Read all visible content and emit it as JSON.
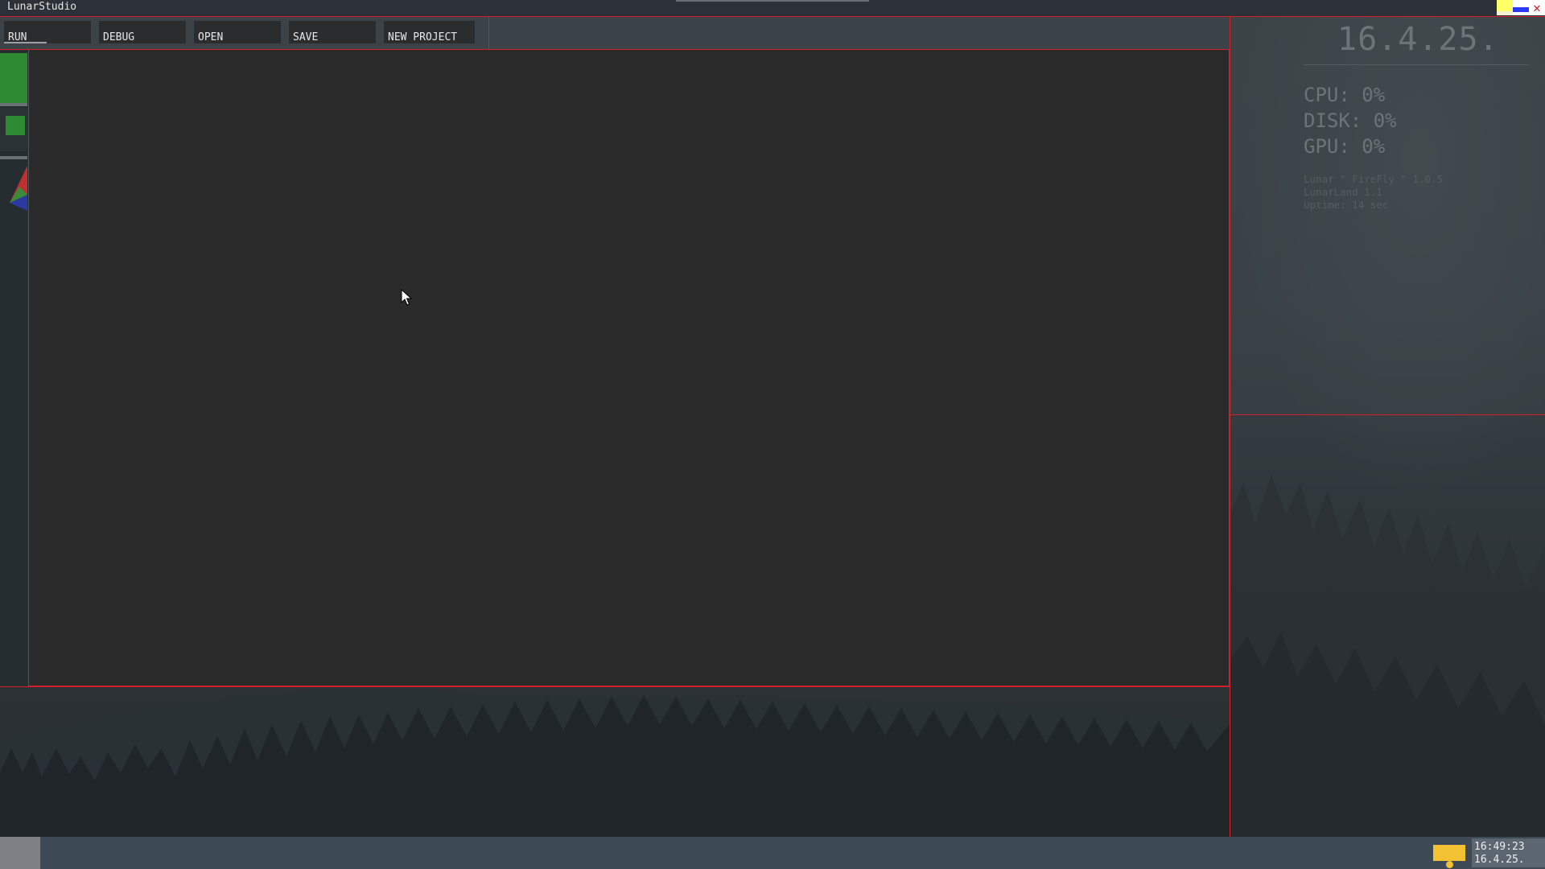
{
  "window": {
    "title": "LunarStudio",
    "controls": [
      "minimize",
      "maximize",
      "close"
    ]
  },
  "toolbar": {
    "buttons": [
      {
        "id": "run",
        "label": "RUN"
      },
      {
        "id": "debug",
        "label": "DEBUG"
      },
      {
        "id": "open",
        "label": "OPEN"
      },
      {
        "id": "save",
        "label": "SAVE"
      },
      {
        "id": "new_project",
        "label": "NEW PROJECT"
      }
    ]
  },
  "system_monitor": {
    "date": "16.4.25.",
    "cpu": "CPU: 0%",
    "disk": "DISK: 0%",
    "gpu": "GPU: 0%",
    "os_version": "Lunar \" FireFly \" 1.0.5",
    "land_version": "LunarLand 1.1",
    "uptime": "Uptime: 14 sec"
  },
  "taskbar": {
    "time": "16:49:23",
    "date": "16.4.25.",
    "tray_icon": "monitor-icon"
  },
  "colors": {
    "accent_border": "#d0202a",
    "editor_bg": "#2a2a2a",
    "dock_green": "#2f8a34",
    "tray_yellow": "#f2c233",
    "taskbar_bg": "#3d4a55"
  },
  "icons": {
    "close": "close-icon",
    "cursor": "mouse-pointer-icon",
    "dock_logo": "lunar-logo-icon"
  }
}
